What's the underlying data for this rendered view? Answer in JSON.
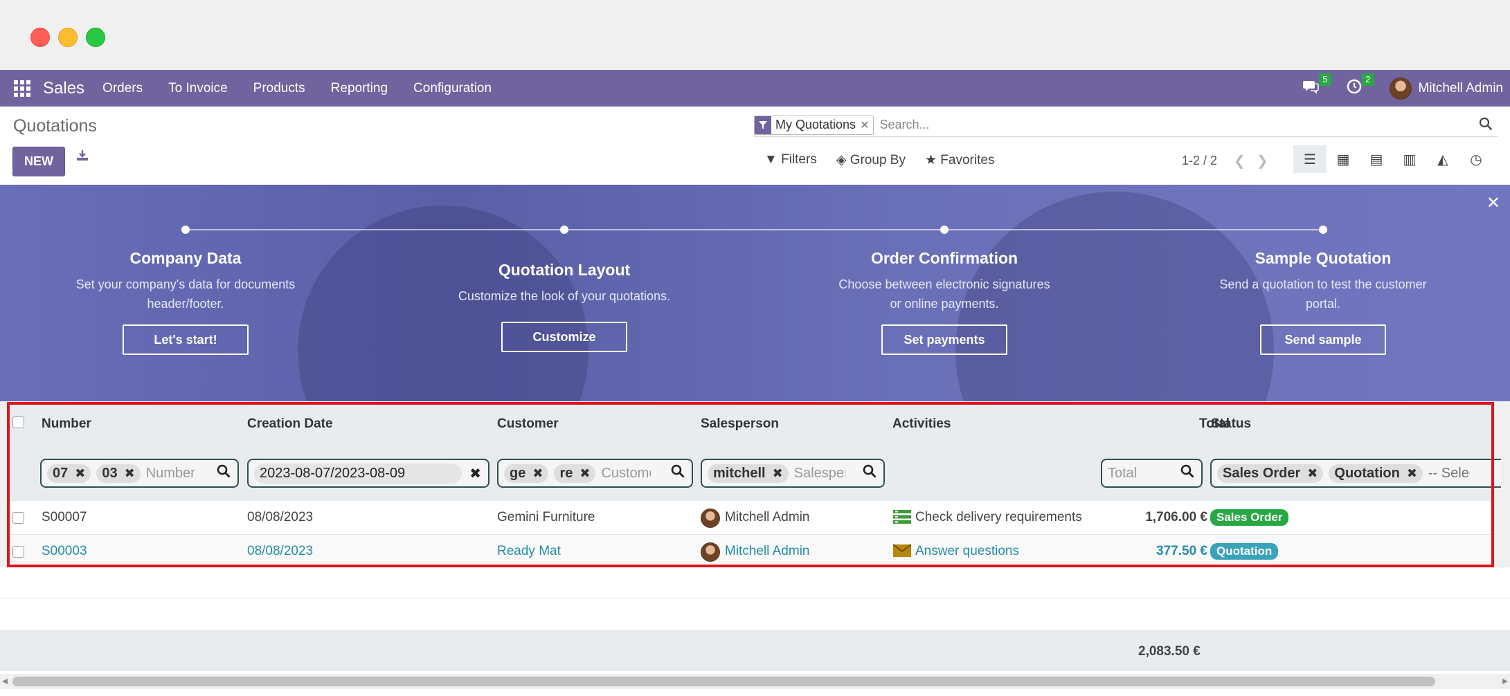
{
  "navbar": {
    "brand": "Sales",
    "menu": [
      "Orders",
      "To Invoice",
      "Products",
      "Reporting",
      "Configuration"
    ],
    "messages_count": "5",
    "activities_count": "2",
    "user_name": "Mitchell Admin"
  },
  "control": {
    "page_title": "Quotations",
    "new_label": "NEW",
    "facet_label": "My Quotations",
    "search_placeholder": "Search...",
    "filters_label": "Filters",
    "groupby_label": "Group By",
    "favorites_label": "Favorites",
    "pager": "1-2 / 2"
  },
  "banner": {
    "steps": [
      {
        "title": "Company Data",
        "desc1": "Set your company's data for documents",
        "desc2": "header/footer.",
        "button": "Let's start!"
      },
      {
        "title": "Quotation Layout",
        "desc1": "Customize the look of your quotations.",
        "desc2": "",
        "button": "Customize"
      },
      {
        "title": "Order Confirmation",
        "desc1": "Choose between electronic signatures",
        "desc2": "or online payments.",
        "button": "Set payments"
      },
      {
        "title": "Sample Quotation",
        "desc1": "Send a quotation to test the customer",
        "desc2": "portal.",
        "button": "Send sample"
      }
    ]
  },
  "table": {
    "columns": [
      "Number",
      "Creation Date",
      "Customer",
      "Salesperson",
      "Activities",
      "Total",
      "Status"
    ],
    "filters": {
      "number_chips": [
        "07",
        "03"
      ],
      "number_placeholder": "Number",
      "date_value": "2023-08-07/2023-08-09",
      "customer_chips": [
        "ge",
        "re"
      ],
      "customer_placeholder": "Customer",
      "salesperson_chips": [
        "mitchell"
      ],
      "salesperson_placeholder": "Salesperson",
      "total_placeholder": "Total",
      "status_chips": [
        "Sales Order",
        "Quotation"
      ],
      "status_placeholder": "-- Select --"
    },
    "rows": [
      {
        "number": "S00007",
        "date": "08/08/2023",
        "customer": "Gemini Furniture",
        "salesperson": "Mitchell Admin",
        "activity": "Check delivery requirements",
        "total": "1,706.00 €",
        "status": "Sales Order",
        "status_color": "#28a745"
      },
      {
        "number": "S00003",
        "date": "08/08/2023",
        "customer": "Ready Mat",
        "salesperson": "Mitchell Admin",
        "activity": "Answer questions",
        "total": "377.50 €",
        "status": "Quotation",
        "status_color": "#3aa3ba"
      }
    ],
    "grand_total": "2,083.50 €"
  },
  "colors": {
    "brand": "#71639e",
    "highlight": "#e0131a",
    "link": "#258ba6"
  }
}
